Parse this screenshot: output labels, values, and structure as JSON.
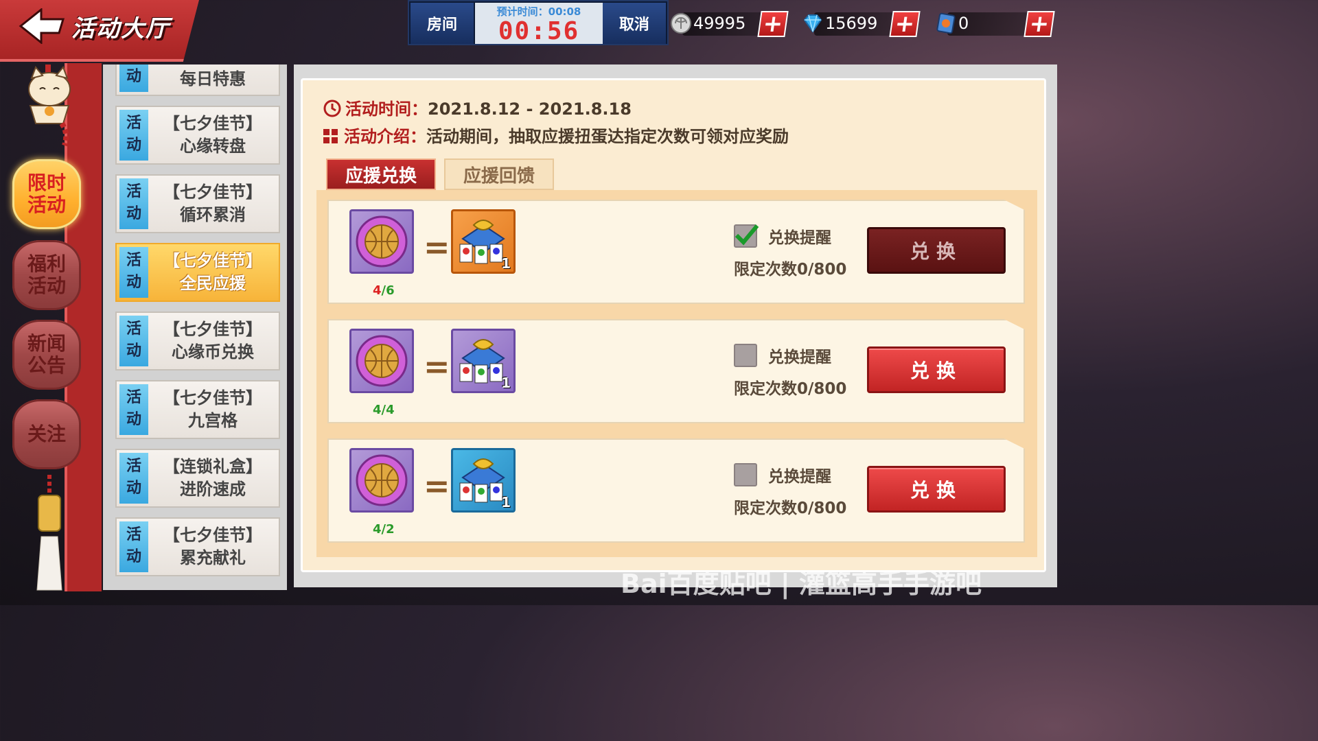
{
  "header": {
    "title": "活动大厅",
    "matchmaking": {
      "room_label": "房间",
      "estimate_label": "预计时间：00:08",
      "timer": "00:56",
      "cancel_label": "取消"
    },
    "currencies": [
      {
        "icon": "silver-coin-icon",
        "value": "49995"
      },
      {
        "icon": "diamond-icon",
        "value": "15699"
      },
      {
        "icon": "ticket-card-icon",
        "value": "0"
      }
    ]
  },
  "left_nav": [
    {
      "label": "限时\n活动",
      "active": true
    },
    {
      "label": "福利\n活动",
      "active": false
    },
    {
      "label": "新闻\n公告",
      "active": false
    },
    {
      "label": "关注",
      "active": false
    }
  ],
  "activities": [
    {
      "tag": "活\n动",
      "line1": "每日特惠",
      "line2": "",
      "active": false
    },
    {
      "tag": "活\n动",
      "line1": "【七夕佳节】",
      "line2": "心缘转盘",
      "active": false
    },
    {
      "tag": "活\n动",
      "line1": "【七夕佳节】",
      "line2": "循环累消",
      "active": false
    },
    {
      "tag": "活\n动",
      "line1": "【七夕佳节】",
      "line2": "全民应援",
      "active": true
    },
    {
      "tag": "活\n动",
      "line1": "【七夕佳节】",
      "line2": "心缘币兑换",
      "active": false
    },
    {
      "tag": "活\n动",
      "line1": "【七夕佳节】",
      "line2": "九宫格",
      "active": false
    },
    {
      "tag": "活\n动",
      "line1": "【连锁礼盒】",
      "line2": "进阶速成",
      "active": false
    },
    {
      "tag": "活\n动",
      "line1": "【七夕佳节】",
      "line2": "累充献礼",
      "active": false
    }
  ],
  "main": {
    "time_label": "活动时间：",
    "time_value": "2021.8.12 - 2021.8.18",
    "intro_label": "活动介绍：",
    "intro_value": "活动期间，抽取应援扭蛋达指定次数可领对应奖励",
    "tabs": [
      "应援兑换",
      "应援回馈"
    ],
    "rows": [
      {
        "have": "4",
        "need": "6",
        "enough": false,
        "reward_count": "1",
        "reward_color": "orange",
        "remind_label": "兑换提醒",
        "remind_checked": true,
        "limit_label": "限定次数0/800",
        "button_label": "兑换",
        "button_enabled": false
      },
      {
        "have": "4",
        "need": "4",
        "enough": true,
        "reward_count": "1",
        "reward_color": "purple",
        "remind_label": "兑换提醒",
        "remind_checked": false,
        "limit_label": "限定次数0/800",
        "button_label": "兑换",
        "button_enabled": true
      },
      {
        "have": "4",
        "need": "2",
        "enough": true,
        "reward_count": "1",
        "reward_color": "blue",
        "remind_label": "兑换提醒",
        "remind_checked": false,
        "limit_label": "限定次数0/800",
        "button_label": "兑换",
        "button_enabled": true
      }
    ]
  },
  "watermark": "Bai百度贴吧 | 灌篮高手手游吧"
}
